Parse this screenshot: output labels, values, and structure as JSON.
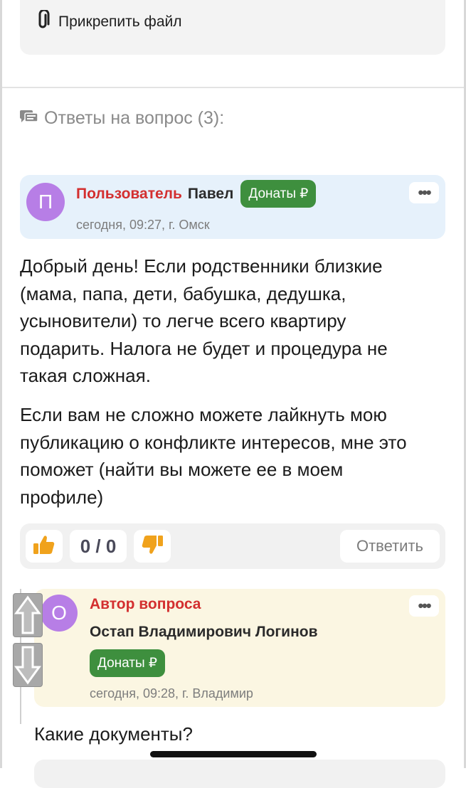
{
  "attach": {
    "label": "Прикрепить файл",
    "icon": "paperclip-icon"
  },
  "answers": {
    "heading": "Ответы на вопрос (3):",
    "icon": "comments-icon"
  },
  "answer": {
    "avatar_letter": "П",
    "role": "Пользователь",
    "name": "Павел",
    "donate": "Донаты ₽",
    "meta": "сегодня, 09:27,  г. Омск",
    "menu": "•••",
    "paragraphs": [
      [
        "Добрый день! Если родственники близкие",
        "(мама, папа, дети, бабушка, дедушка,",
        "усыновители) то легче всего квартиру",
        "подарить. Налога не будет и процедура не",
        "такая сложная."
      ],
      [
        "Если вам не сложно можете лайкнуть мою",
        "публикацию о конфликте интересов, мне это",
        "поможет (найти вы можете ее в моем",
        "профиле)"
      ]
    ],
    "votes": "0 / 0",
    "reply": "Ответить"
  },
  "comment": {
    "avatar_letter": "О",
    "role": "Автор вопроса",
    "name": "Остап Владимирович Логинов",
    "donate": "Донаты ₽",
    "meta": "сегодня, 09:28,  г. Владимир",
    "menu": "•••",
    "text": "Какие документы?"
  },
  "colors": {
    "accent_red": "#d32f2f",
    "donate_green": "#3e8f3e",
    "avatar_purple": "#b77ee6",
    "vote_orange": "#f0a21c"
  }
}
